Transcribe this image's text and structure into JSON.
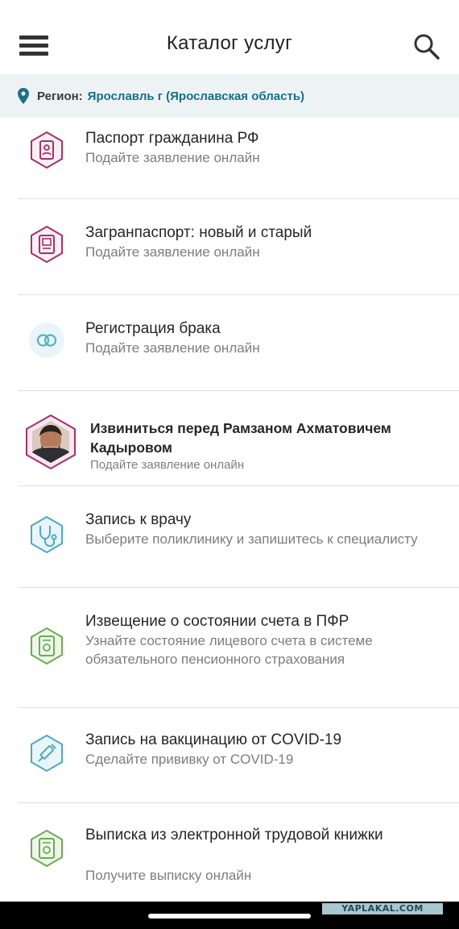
{
  "header": {
    "title": "Каталог услуг",
    "menu_icon": "hamburger-menu-icon",
    "search_icon": "search-icon"
  },
  "region": {
    "label": "Регион:",
    "value": "Ярославль г (Ярославская область)",
    "icon": "location-pin-icon"
  },
  "services": [
    {
      "title": "Паспорт гражданина РФ",
      "subtitle": "Подайте заявление онлайн",
      "icon": "passport-icon"
    },
    {
      "title": "Загранпаспорт: новый и старый",
      "subtitle": "Подайте заявление онлайн",
      "icon": "foreign-passport-icon"
    },
    {
      "title": "Регистрация брака",
      "subtitle": "Подайте заявление онлайн",
      "icon": "wedding-rings-icon"
    },
    {
      "title": "Извиниться перед Рамзаном Ахматовичем Кадыровом",
      "subtitle": "Подайте заявление онлайн",
      "icon": "portrait-avatar-icon"
    },
    {
      "title": "Запись к врачу",
      "subtitle": "Выберите поликлинику и запишитесь к специалисту",
      "icon": "stethoscope-icon"
    },
    {
      "title": "Извещение о состоянии счета в ПФР",
      "subtitle": "Узнайте состояние лицевого счета в системе обязательного пенсионного страхования",
      "icon": "pension-document-icon"
    },
    {
      "title": "Запись на вакцинацию от COVID-19",
      "subtitle": "Сделайте прививку от COVID-19",
      "icon": "syringe-icon"
    },
    {
      "title": "Выписка из электронной трудовой книжки",
      "subtitle": "Получите выписку онлайн",
      "icon": "work-book-icon"
    }
  ],
  "colors": {
    "accent": "#176f8a",
    "passport": "#a3326a",
    "rings": "#54b0c8",
    "medical": "#4fa9c2",
    "pension": "#6cab53",
    "region_bg": "#edf3f5"
  },
  "watermark": "YAPLAKAL.COM"
}
